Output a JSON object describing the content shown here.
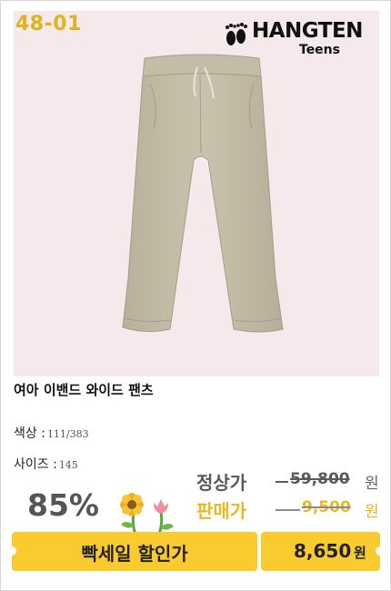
{
  "product": {
    "code": "48-01",
    "brand": {
      "name": "HANGTEN",
      "sub": "Teens"
    },
    "title": "여아 이밴드 와이드 팬츠",
    "color_label": "색상 :",
    "color_value": "111/383",
    "size_label": "사이즈 :",
    "size_value": "145",
    "colors": {
      "pants": "#c4bca7",
      "photo_bg": "#f5e9ec",
      "accent": "#f9cb2e"
    }
  },
  "pricing": {
    "discount": "85%",
    "regular_label": "정상가",
    "regular_price": "59,800",
    "sale_label": "판매가",
    "sale_price": "9,500",
    "currency": "원"
  },
  "banner": {
    "label": "빡세일 할인가",
    "final_price": "8,650",
    "currency": "원"
  }
}
